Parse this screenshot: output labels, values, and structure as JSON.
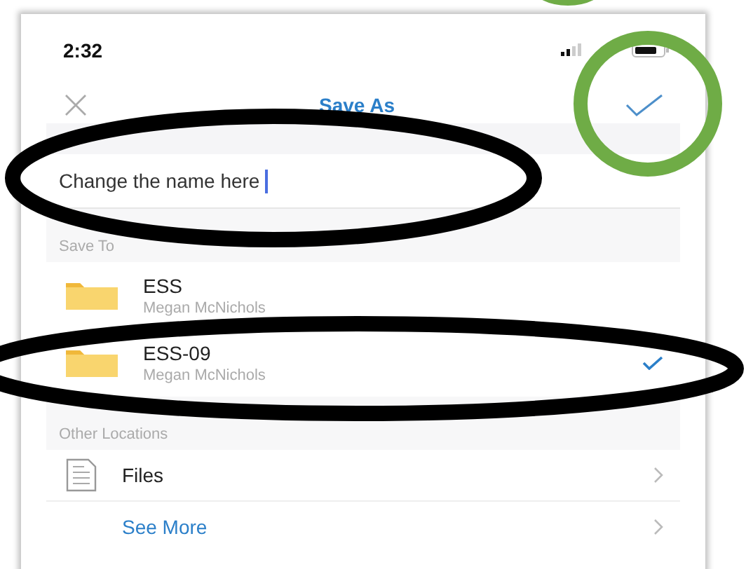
{
  "status_bar": {
    "time": "2:32"
  },
  "nav": {
    "title": "Save As"
  },
  "name_field": {
    "value": "Change the name here"
  },
  "sections": [
    {
      "header": "Save To",
      "items": [
        {
          "kind": "folder",
          "name": "ESS",
          "owner": "Megan McNichols",
          "selected": false
        },
        {
          "kind": "folder",
          "name": "ESS-09",
          "owner": "Megan McNichols",
          "selected": true
        }
      ]
    },
    {
      "header": "Other Locations",
      "items": [
        {
          "kind": "file",
          "name": "Files"
        },
        {
          "kind": "link",
          "name": "See More"
        }
      ]
    }
  ]
}
